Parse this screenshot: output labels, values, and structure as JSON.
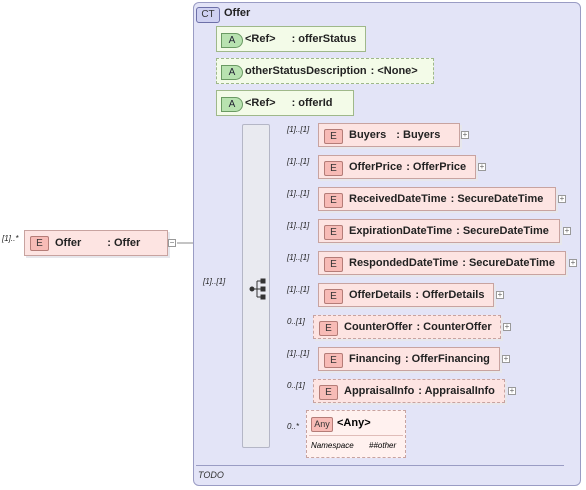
{
  "complex_type": {
    "badge": "CT",
    "name": "Offer",
    "annotation": "TODO"
  },
  "root_element": {
    "badge": "E",
    "name": "Offer",
    "type": ": Offer",
    "cardinality": "[1]..*",
    "collapse": "−"
  },
  "attributes": [
    {
      "badge": "A",
      "name": "<Ref>",
      "type": ": offerStatus"
    },
    {
      "badge": "A",
      "name": "otherStatusDescription",
      "type": ": <None>"
    },
    {
      "badge": "A",
      "name": "<Ref>",
      "type": ": offerId"
    }
  ],
  "sequence": {
    "cardinality": "[1]..[1]"
  },
  "elements": [
    {
      "badge": "E",
      "name": "Buyers",
      "type": ": Buyers",
      "cardinality": "[1]..[1]",
      "optional": false
    },
    {
      "badge": "E",
      "name": "OfferPrice",
      "type": ": OfferPrice",
      "cardinality": "[1]..[1]",
      "optional": false
    },
    {
      "badge": "E",
      "name": "ReceivedDateTime",
      "type": ": SecureDateTime",
      "cardinality": "[1]..[1]",
      "optional": false
    },
    {
      "badge": "E",
      "name": "ExpirationDateTime",
      "type": ": SecureDateTime",
      "cardinality": "[1]..[1]",
      "optional": false
    },
    {
      "badge": "E",
      "name": "RespondedDateTime",
      "type": ": SecureDateTime",
      "cardinality": "[1]..[1]",
      "optional": false
    },
    {
      "badge": "E",
      "name": "OfferDetails",
      "type": ": OfferDetails",
      "cardinality": "[1]..[1]",
      "optional": false
    },
    {
      "badge": "E",
      "name": "CounterOffer",
      "type": ": CounterOffer",
      "cardinality": "0..[1]",
      "optional": true
    },
    {
      "badge": "E",
      "name": "Financing",
      "type": ": OfferFinancing",
      "cardinality": "[1]..[1]",
      "optional": false
    },
    {
      "badge": "E",
      "name": "AppraisalInfo",
      "type": ": AppraisalInfo",
      "cardinality": "0..[1]",
      "optional": true
    }
  ],
  "any": {
    "badge": "Any",
    "label": "<Any>",
    "cardinality": "0..*",
    "namespace_key": "Namespace",
    "namespace_value": "##other"
  },
  "expand_symbol": "+"
}
